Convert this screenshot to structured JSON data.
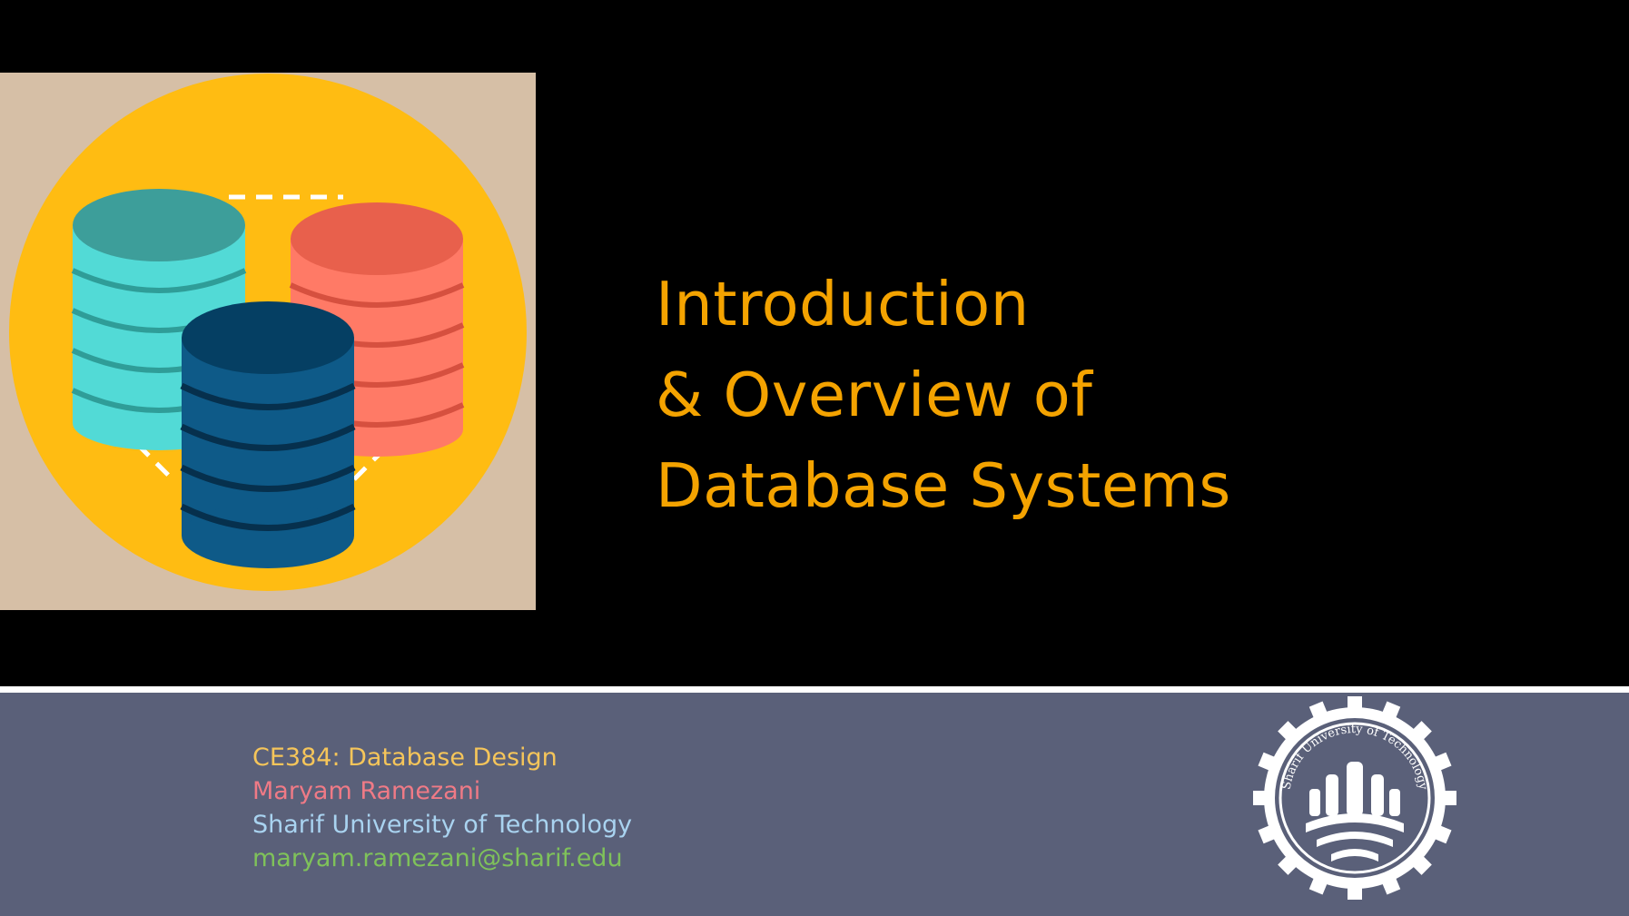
{
  "slide": {
    "title_lines": [
      "Introduction",
      "& Overview of",
      "Database Systems"
    ],
    "footer": {
      "course": "CE384: Database Design",
      "author": "Maryam Ramezani",
      "university": "Sharif University of Technology",
      "email": "maryam.ramezani@sharif.edu"
    },
    "seal_text": "Sharif University of Technology",
    "colors": {
      "background": "#000000",
      "title": "#f4a300",
      "footer_bar": "#5a6079",
      "course": "#f5c55a",
      "author": "#ef7a86",
      "university": "#a9d3f0",
      "email": "#7fc25a",
      "illustration_bg": "#d6bfa6",
      "illustration_circle": "#ffbc12"
    },
    "icons": [
      "database-stack-illustration",
      "university-seal-logo"
    ]
  }
}
